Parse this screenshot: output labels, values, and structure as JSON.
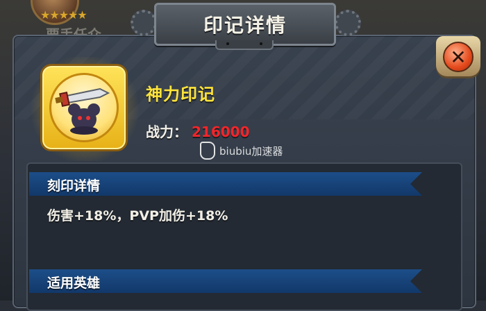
{
  "background": {
    "star_rating": 5,
    "faded_text": "要手任众"
  },
  "dialog": {
    "title": "印记详情",
    "close_glyph": "✕"
  },
  "item": {
    "name": "神力印记",
    "power_label": "战力：",
    "power_value": "216000",
    "icon": "sword-mouse-emblem-icon"
  },
  "watermark": {
    "text": "biubiu加速器"
  },
  "sections": {
    "engrave_title": "刻印详情",
    "engrave_effect": "伤害+18%，PVP加伤+18%",
    "heroes_title": "适用英雄"
  },
  "colors": {
    "item_name": "#ffe43a",
    "power_value": "#f3252a",
    "section_bar": "#1c4e88"
  }
}
